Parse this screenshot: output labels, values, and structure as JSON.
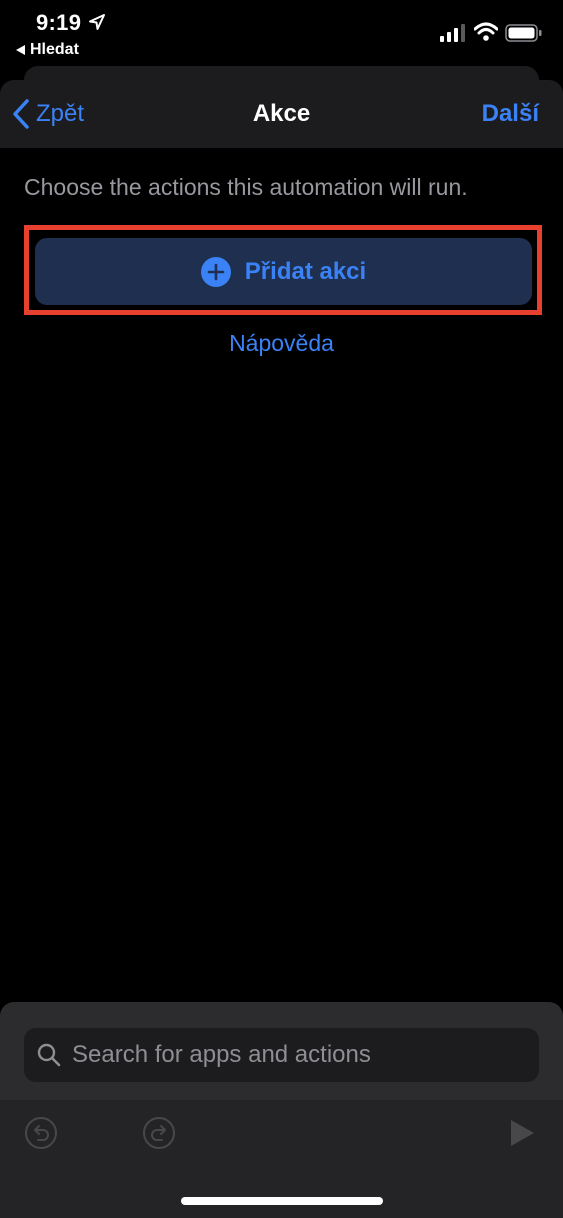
{
  "status_bar": {
    "time": "9:19",
    "back_app_label": "Hledat",
    "icons": [
      "location-arrow-icon",
      "signal-icon",
      "wifi-icon",
      "battery-icon"
    ]
  },
  "nav": {
    "back_label": "Zpět",
    "title": "Akce",
    "next_label": "Další"
  },
  "content": {
    "instruction": "Choose the actions this automation will run.",
    "add_action_label": "Přidat akci",
    "help_label": "Nápověda"
  },
  "bottom_sheet": {
    "search_placeholder": "Search for apps and actions",
    "search_value": "",
    "toolbar_icons": [
      "undo-icon",
      "redo-icon",
      "play-icon"
    ]
  },
  "colors": {
    "background": "#000000",
    "accent": "#3b82f6",
    "nav_background": "#1c1c1e",
    "button_background": "#1e2f4f",
    "highlight": "#e8402f",
    "secondary_text": "#98989f"
  }
}
